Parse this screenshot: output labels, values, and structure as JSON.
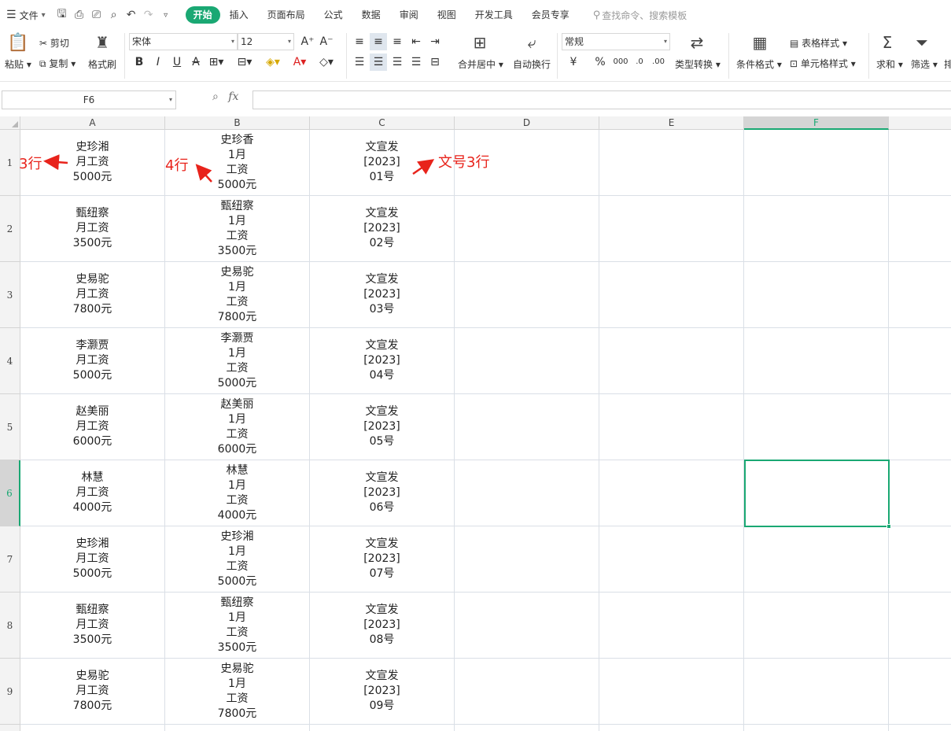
{
  "menubar": {
    "file_label": "文件",
    "tabs": [
      "开始",
      "插入",
      "页面布局",
      "公式",
      "数据",
      "审阅",
      "视图",
      "开发工具",
      "会员专享"
    ],
    "active_tab": "开始",
    "search_placeholder": "查找命令、搜索模板"
  },
  "ribbon": {
    "paste": "粘贴",
    "cut": "剪切",
    "copy": "复制",
    "format_painter": "格式刷",
    "font_name": "宋体",
    "font_size": "12",
    "merge_center": "合并居中",
    "wrap_text": "自动换行",
    "number_format": "常规",
    "type_convert": "类型转换",
    "conditional_format": "条件格式",
    "table_style": "表格样式",
    "cell_style": "单元格样式",
    "sum": "求和",
    "filter": "筛选",
    "sort_partial": "排"
  },
  "formula_bar": {
    "name_box": "F6",
    "fx": "fx",
    "content": ""
  },
  "grid": {
    "columns": [
      "A",
      "B",
      "C",
      "D",
      "E",
      "F"
    ],
    "selected_column": "F",
    "selected_row": "6",
    "rows": [
      {
        "num": "1",
        "a": [
          "史珍湘",
          "月工资",
          "5000元"
        ],
        "b": [
          "史珍香",
          "1月",
          "工资",
          "5000元"
        ],
        "c": [
          "文宣发",
          "[2023]",
          "01号"
        ]
      },
      {
        "num": "2",
        "a": [
          "甄纽察",
          "月工资",
          "3500元"
        ],
        "b": [
          "甄纽察",
          "1月",
          "工资",
          "3500元"
        ],
        "c": [
          "文宣发",
          "[2023]",
          "02号"
        ]
      },
      {
        "num": "3",
        "a": [
          "史易驼",
          "月工资",
          "7800元"
        ],
        "b": [
          "史易驼",
          "1月",
          "工资",
          "7800元"
        ],
        "c": [
          "文宣发",
          "[2023]",
          "03号"
        ]
      },
      {
        "num": "4",
        "a": [
          "李灏贾",
          "月工资",
          "5000元"
        ],
        "b": [
          "李灏贾",
          "1月",
          "工资",
          "5000元"
        ],
        "c": [
          "文宣发",
          "[2023]",
          "04号"
        ]
      },
      {
        "num": "5",
        "a": [
          "赵美丽",
          "月工资",
          "6000元"
        ],
        "b": [
          "赵美丽",
          "1月",
          "工资",
          "6000元"
        ],
        "c": [
          "文宣发",
          "[2023]",
          "05号"
        ]
      },
      {
        "num": "6",
        "a": [
          "林慧",
          "月工资",
          "4000元"
        ],
        "b": [
          "林慧",
          "1月",
          "工资",
          "4000元"
        ],
        "c": [
          "文宣发",
          "[2023]",
          "06号"
        ]
      },
      {
        "num": "7",
        "a": [
          "史珍湘",
          "月工资",
          "5000元"
        ],
        "b": [
          "史珍湘",
          "1月",
          "工资",
          "5000元"
        ],
        "c": [
          "文宣发",
          "[2023]",
          "07号"
        ]
      },
      {
        "num": "8",
        "a": [
          "甄纽察",
          "月工资",
          "3500元"
        ],
        "b": [
          "甄纽察",
          "1月",
          "工资",
          "3500元"
        ],
        "c": [
          "文宣发",
          "[2023]",
          "08号"
        ]
      },
      {
        "num": "9",
        "a": [
          "史易驼",
          "月工资",
          "7800元"
        ],
        "b": [
          "史易驼",
          "1月",
          "工资",
          "7800元"
        ],
        "c": [
          "文宣发",
          "[2023]",
          "09号"
        ]
      }
    ]
  },
  "annotations": {
    "a_rows": "3行",
    "b_rows": "4行",
    "c_rows": "文号3行",
    "color": "#e8231b"
  }
}
